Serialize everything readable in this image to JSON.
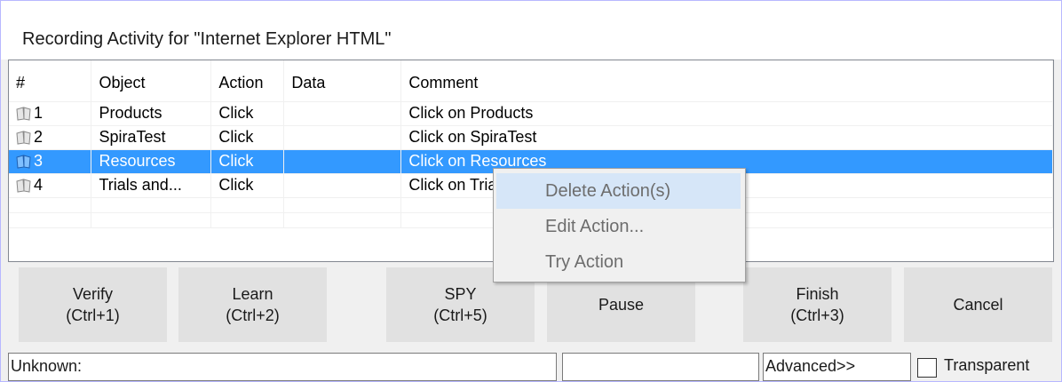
{
  "window": {
    "title": "Recording Activity for \"Internet Explorer HTML\""
  },
  "grid": {
    "columns": [
      "#",
      "Object",
      "Action",
      "Data",
      "Comment"
    ],
    "rows": [
      {
        "num": "1",
        "object": "Products",
        "action": "Click",
        "data": "",
        "comment": "Click on Products",
        "selected": false
      },
      {
        "num": "2",
        "object": "SpiraTest",
        "action": "Click",
        "data": "",
        "comment": "Click on SpiraTest",
        "selected": false
      },
      {
        "num": "3",
        "object": "Resources",
        "action": "Click",
        "data": "",
        "comment": "Click on Resources",
        "selected": true
      },
      {
        "num": "4",
        "object": "Trials and...",
        "action": "Click",
        "data": "",
        "comment": "Click on Trials and...",
        "selected": false
      }
    ],
    "row_icon": "book-icon"
  },
  "context_menu": {
    "items": [
      {
        "label": "Delete Action(s)",
        "highlighted": true
      },
      {
        "label": "Edit Action...",
        "highlighted": false
      },
      {
        "label": "Try Action",
        "highlighted": false
      }
    ]
  },
  "buttons": {
    "verify": {
      "line1": "Verify",
      "line2": "(Ctrl+1)"
    },
    "learn": {
      "line1": "Learn",
      "line2": "(Ctrl+2)"
    },
    "spy": {
      "line1": "SPY",
      "line2": "(Ctrl+5)"
    },
    "pause": {
      "line1": "Pause"
    },
    "finish": {
      "line1": "Finish",
      "line2": "(Ctrl+3)"
    },
    "cancel": {
      "line1": "Cancel"
    }
  },
  "status": {
    "object_type": "Unknown:",
    "info": "",
    "advanced": "Advanced>>",
    "transparent_label": "Transparent",
    "transparent_checked": false
  },
  "colors": {
    "selection": "#3399ff",
    "menu_highlight": "#d6e6f8",
    "button_face": "#e1e1e1"
  }
}
